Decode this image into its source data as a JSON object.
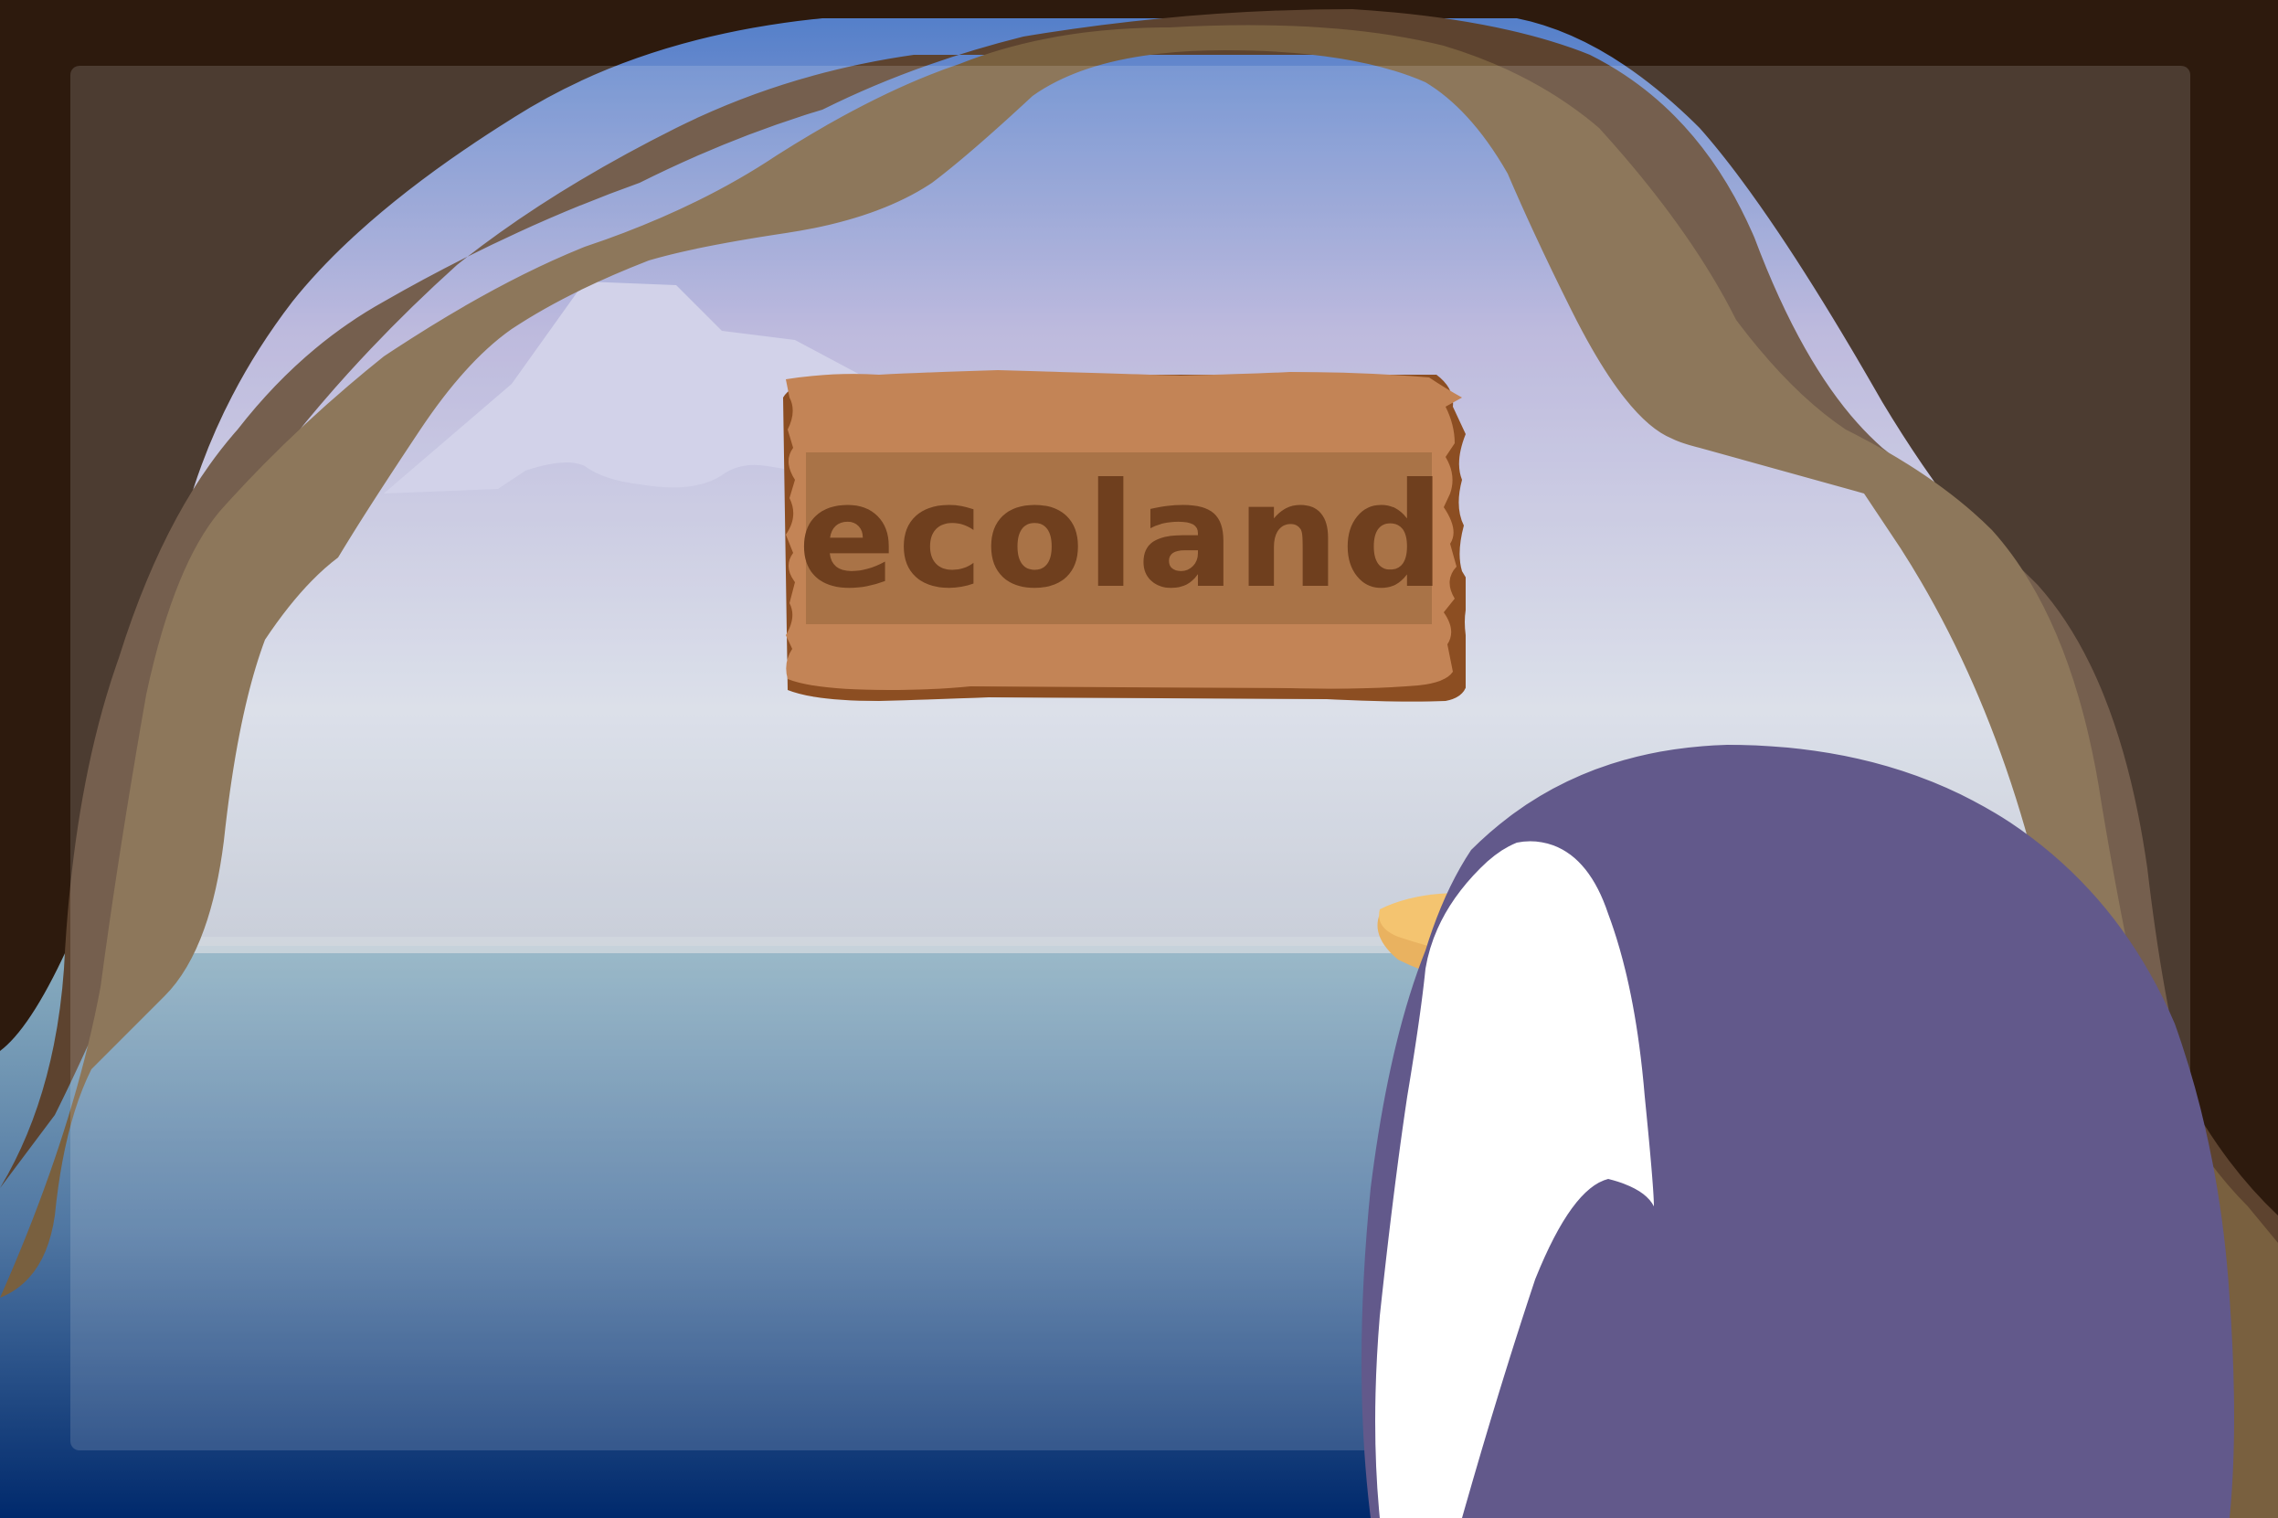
{
  "game": {
    "title": "ecoland"
  },
  "scene": {
    "name": "cave-ocean-view",
    "character": "penguin",
    "colors": {
      "sky_top": "#5b86cf",
      "sky_mid": "#b3afd7",
      "horizon": "#d5d9e4",
      "sea_top": "#8fb0c0",
      "sea_bottom": "#002a6c",
      "cave_dark": "#2d1a0e",
      "cave_mid": "#5a3e2b",
      "cave_light": "#79603f",
      "sign_wood": "#c38456",
      "sign_panel": "#a97347",
      "sign_text": "#6f3f1e",
      "penguin_body": "#62598b",
      "penguin_belly": "#ffffff",
      "penguin_beak": "#f4c470"
    }
  }
}
